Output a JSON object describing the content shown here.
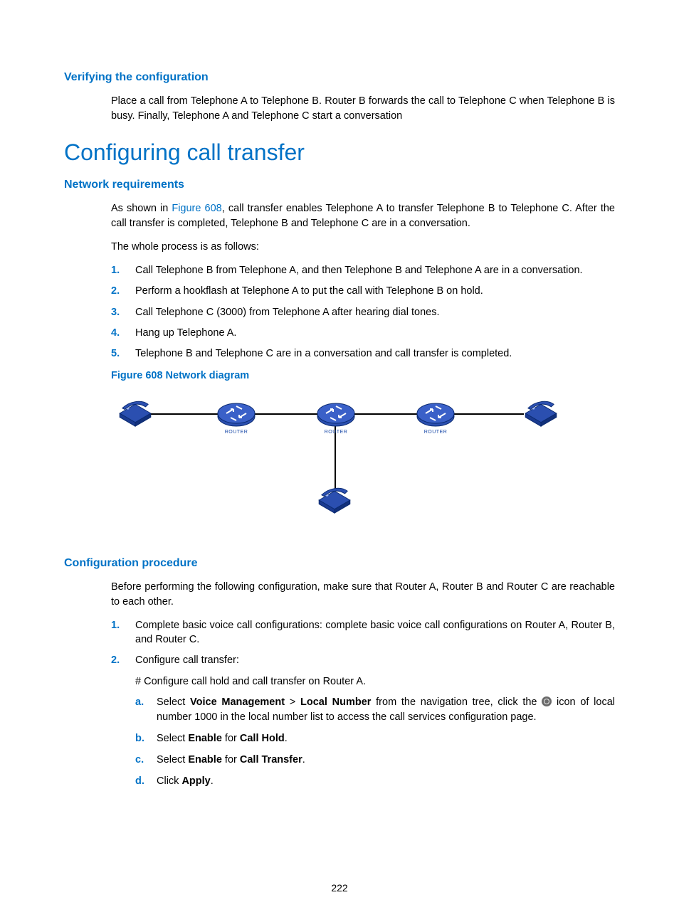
{
  "section1": {
    "heading": "Verifying the configuration",
    "para": "Place a call from Telephone A to Telephone B. Router B forwards the call to Telephone C when Telephone B is busy. Finally, Telephone A and Telephone C start a conversation"
  },
  "main_heading": "Configuring call transfer",
  "section2": {
    "heading": "Network requirements",
    "intro_prefix": "As shown in ",
    "intro_link": "Figure 608",
    "intro_suffix": ", call transfer enables Telephone A to transfer Telephone B to Telephone C. After the call transfer is completed, Telephone B and Telephone C are in a conversation.",
    "para2": "The whole process is as follows:",
    "steps": [
      "Call Telephone B from Telephone A, and then Telephone B and Telephone A are in a conversation.",
      "Perform a hookflash at Telephone A to put the call with Telephone B on hold.",
      "Call Telephone C (3000) from Telephone A after hearing dial tones.",
      "Hang up Telephone A.",
      "Telephone B and Telephone C are in a conversation and call transfer is completed."
    ],
    "figure_caption": "Figure 608 Network diagram"
  },
  "diagram": {
    "router_label": "ROUTER"
  },
  "section3": {
    "heading": "Configuration procedure",
    "intro": "Before performing the following configuration, make sure that Router A, Router B and Router C are reachable to each other.",
    "step1": "Complete basic voice call configurations: complete basic voice call configurations on Router A, Router B, and Router C.",
    "step2": "Configure call transfer:",
    "step2_note": "# Configure call hold and call transfer on Router A.",
    "sub": {
      "a_pre": "Select ",
      "a_b1": "Voice Management",
      "a_mid1": " > ",
      "a_b2": "Local Number",
      "a_mid2": " from the navigation tree, click the ",
      "a_post": " icon of local number 1000 in the local number list to access the call services configuration page.",
      "b_pre": "Select ",
      "b_b1": "Enable",
      "b_mid": " for ",
      "b_b2": "Call Hold",
      "b_post": ".",
      "c_pre": "Select ",
      "c_b1": "Enable",
      "c_mid": " for ",
      "c_b2": "Call Transfer",
      "c_post": ".",
      "d_pre": "Click ",
      "d_b1": "Apply",
      "d_post": "."
    }
  },
  "markers": {
    "n1": "1.",
    "n2": "2.",
    "n3": "3.",
    "n4": "4.",
    "n5": "5.",
    "a": "a.",
    "b": "b.",
    "c": "c.",
    "d": "d."
  },
  "page_number": "222"
}
